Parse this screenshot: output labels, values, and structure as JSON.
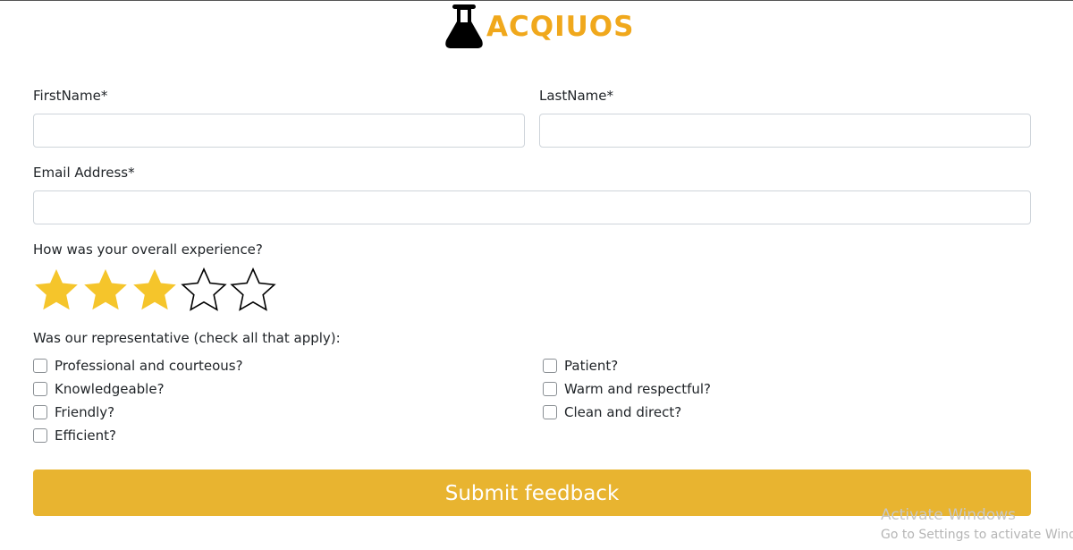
{
  "brand": {
    "name": "ACQIUOS",
    "color": "#f0a81c",
    "icon": "flask-icon"
  },
  "form": {
    "first_name": {
      "label": "FirstName*",
      "value": "",
      "placeholder": ""
    },
    "last_name": {
      "label": "LastName*",
      "value": "",
      "placeholder": ""
    },
    "email": {
      "label": "Email Address*",
      "value": "",
      "placeholder": ""
    },
    "rating": {
      "label": "How was your overall experience?",
      "value": 3,
      "max": 5,
      "filled_color": "#f5c52b",
      "icon": "star-icon"
    },
    "representative": {
      "label": "Was our representative (check all that apply):",
      "options_left": [
        {
          "label": "Professional and courteous?",
          "checked": false
        },
        {
          "label": "Knowledgeable?",
          "checked": false
        },
        {
          "label": "Friendly?",
          "checked": false
        },
        {
          "label": "Efficient?",
          "checked": false
        }
      ],
      "options_right": [
        {
          "label": "Patient?",
          "checked": false
        },
        {
          "label": "Warm and respectful?",
          "checked": false
        },
        {
          "label": "Clean and direct?",
          "checked": false
        }
      ]
    },
    "submit_label": "Submit feedback",
    "submit_color": "#e8b430"
  },
  "watermark": {
    "line1": "Activate Windows",
    "line2": "Go to Settings to activate Windo"
  }
}
